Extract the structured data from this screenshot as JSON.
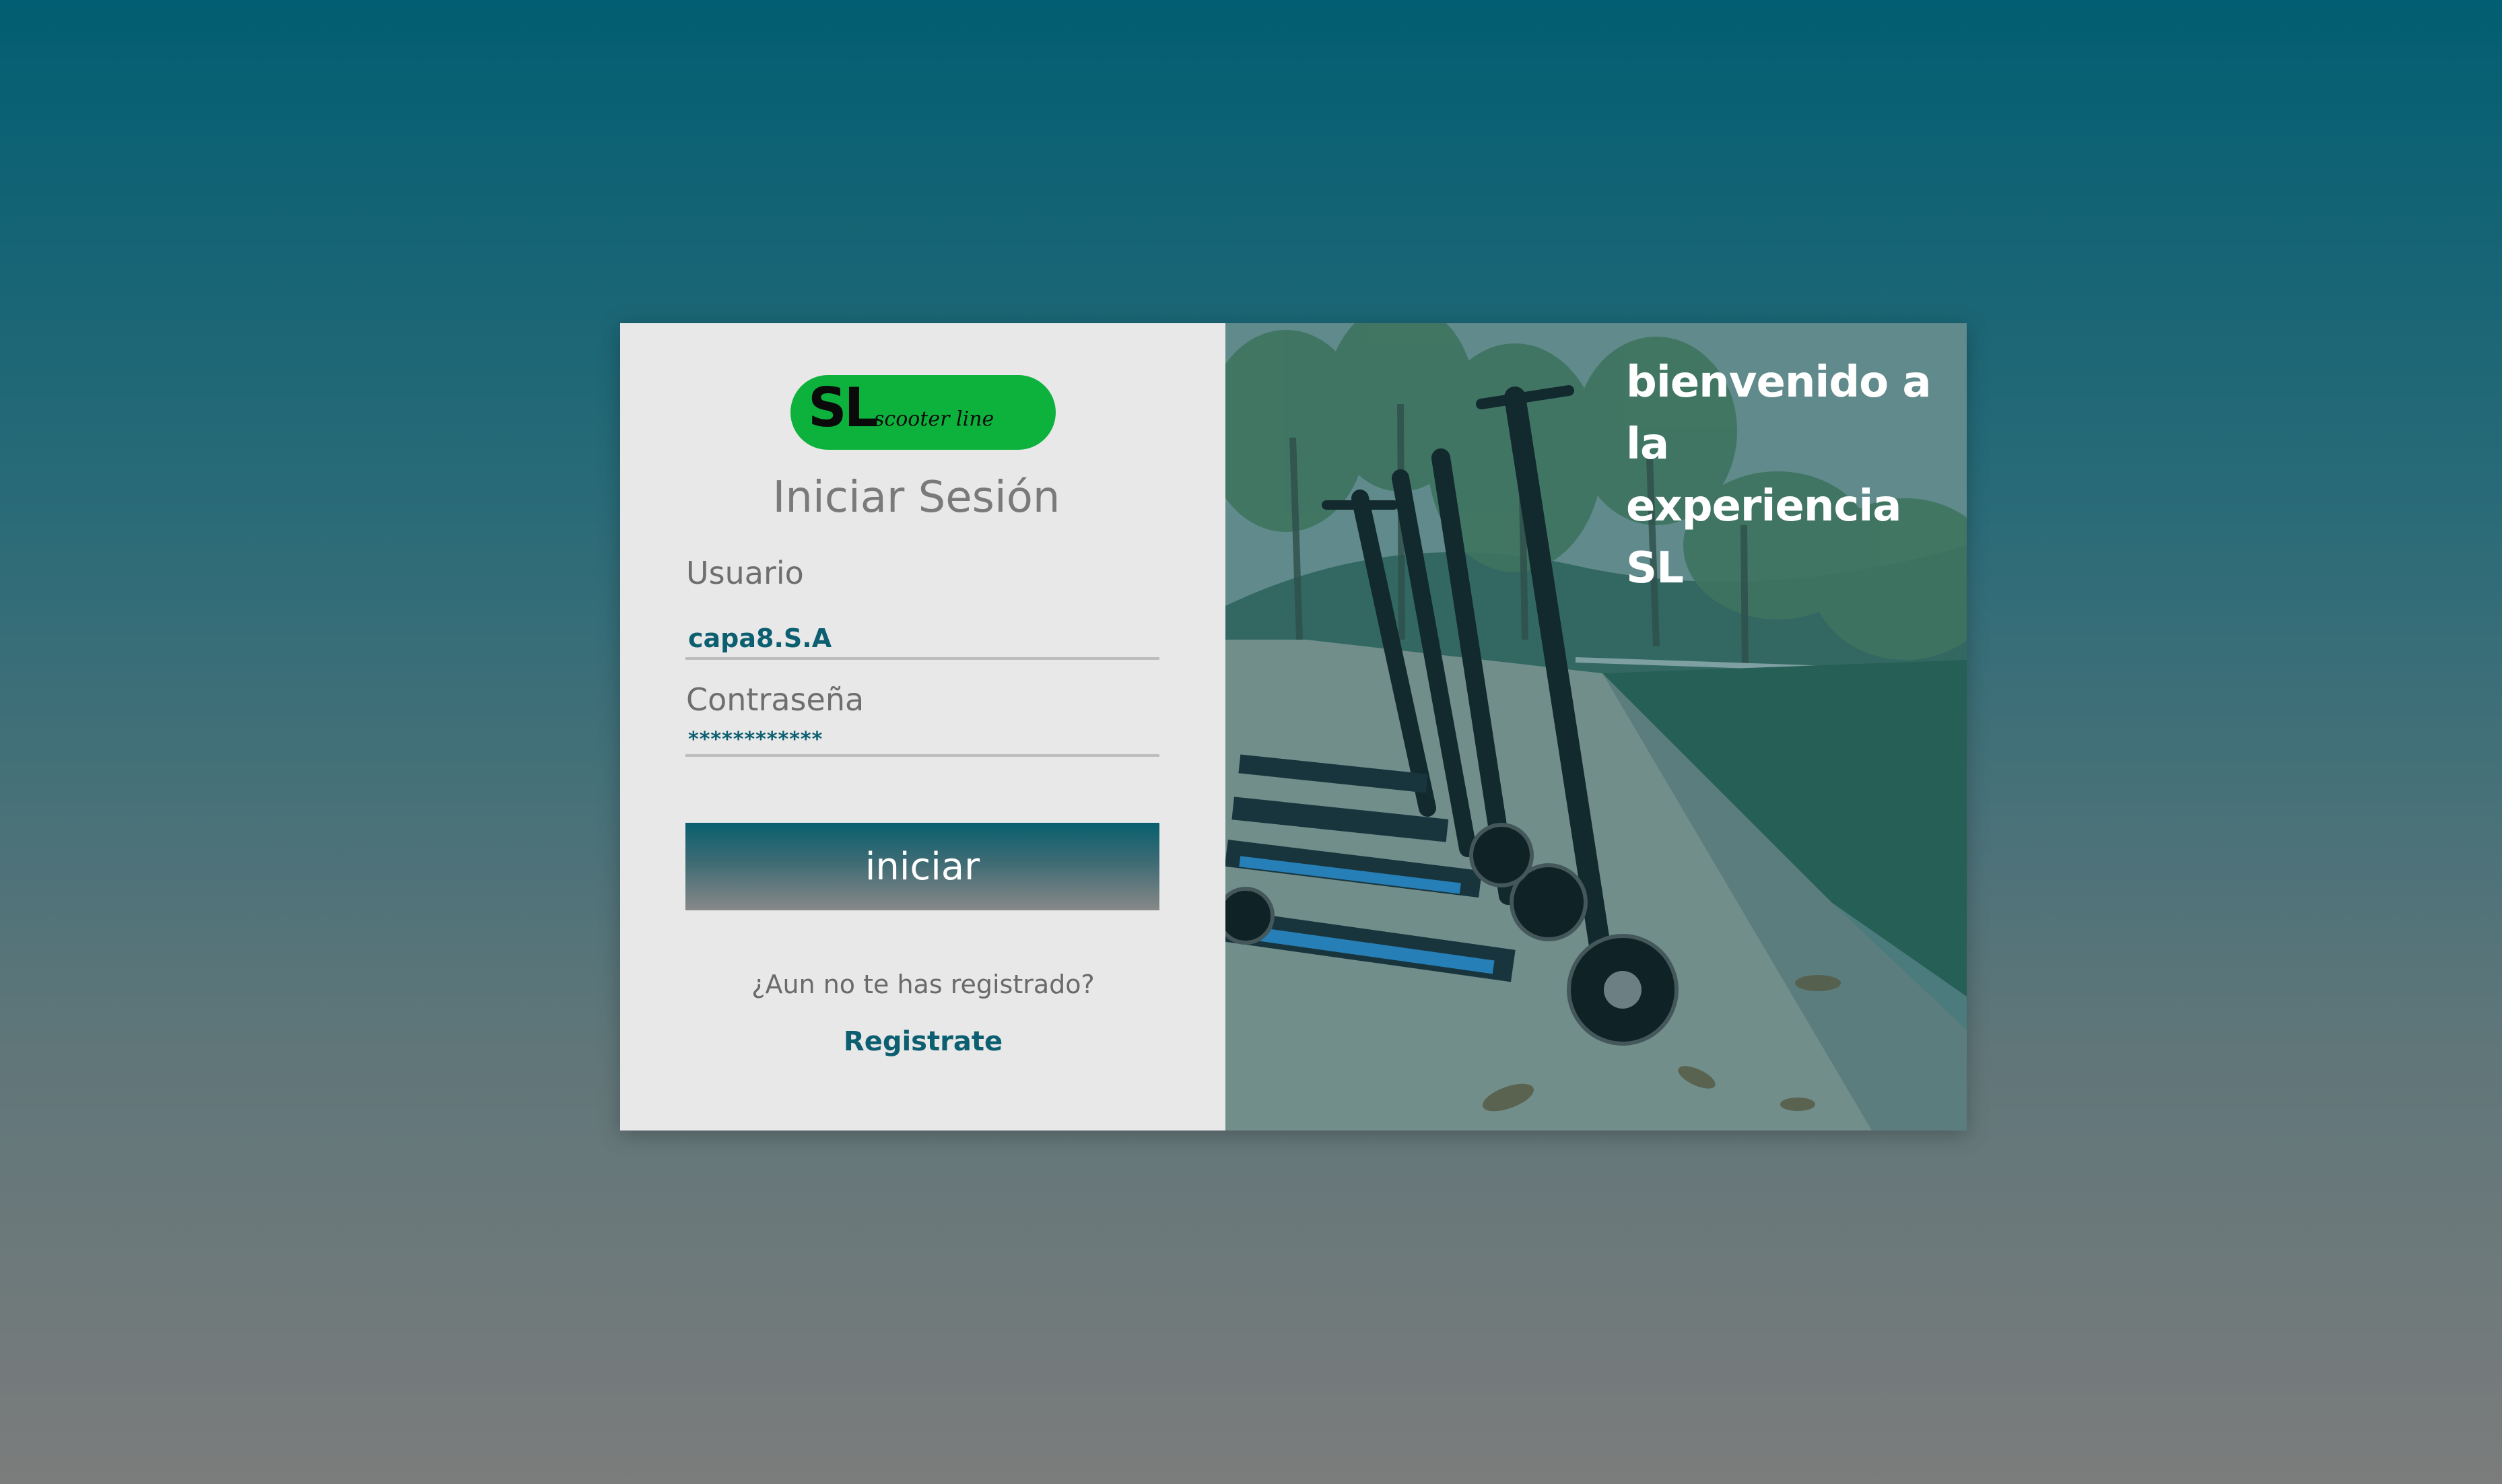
{
  "logo": {
    "main": "SL",
    "tagline": "scooter line"
  },
  "login": {
    "title": "Iniciar Sesión",
    "username_label": "Usuario",
    "username_value": "capa8.S.A",
    "password_label": "Contraseña",
    "password_value": "************",
    "submit_label": "iniciar",
    "register_prompt": "¿Aun no te has registrado?",
    "register_link": "Registrate"
  },
  "hero": {
    "welcome_text": "bienvenido a la experiencia SL",
    "image_description": "row of parked electric scooters on a paved path lined with trees"
  },
  "colors": {
    "accent": "#0c5f70",
    "logo_green": "#0db23c",
    "panel_bg": "#e8e8e8"
  }
}
